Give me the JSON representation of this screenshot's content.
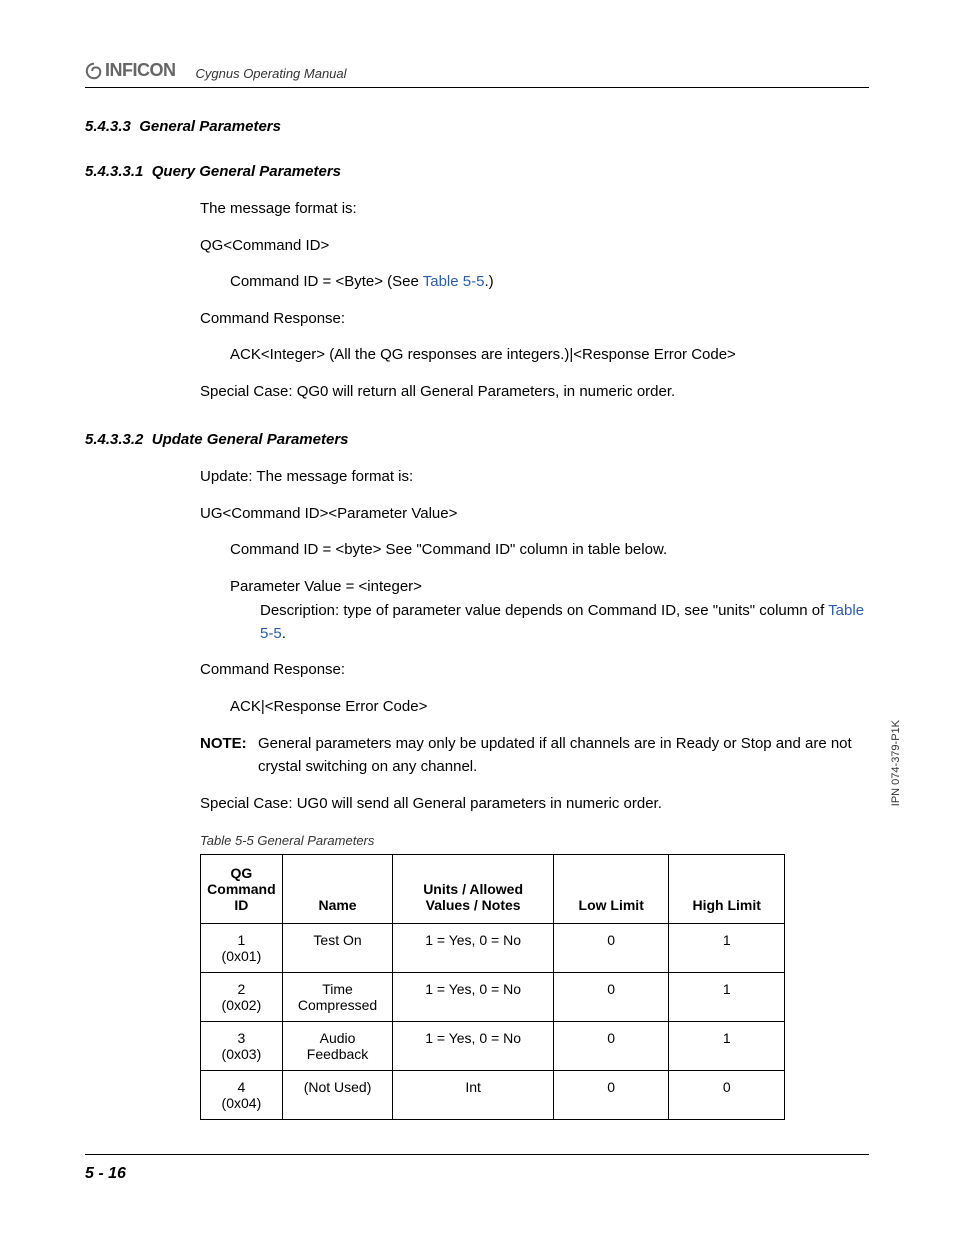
{
  "header": {
    "logo_text": "INFICON",
    "doc_title": "Cygnus Operating Manual"
  },
  "section_5_4_3_3": {
    "number": "5.4.3.3",
    "title": "General Parameters"
  },
  "section_5_4_3_3_1": {
    "number": "5.4.3.3.1",
    "title": "Query General Parameters",
    "msg_format_label": "The message format is:",
    "qg_line": "QG<Command ID>",
    "cmd_id_prefix": "Command ID = <Byte> (See ",
    "cmd_id_link": "Table 5-5",
    "cmd_id_suffix": ".)",
    "cmd_response_label": "Command Response:",
    "ack_line": "ACK<Integer> (All the QG responses are integers.)|<Response Error Code>",
    "special_case": "Special Case: QG0 will return all General Parameters, in numeric order."
  },
  "section_5_4_3_3_2": {
    "number": "5.4.3.3.2",
    "title": "Update General Parameters",
    "update_label": "Update: The message format is:",
    "ug_line": "UG<Command ID><Parameter Value>",
    "cmd_id_line": "Command ID = <byte> See \"Command ID\" column in table below.",
    "param_val_line1": "Parameter Value = <integer>",
    "param_val_desc_prefix": "Description: type of parameter value depends on Command ID, see \"units\" column of ",
    "param_val_link": "Table 5-5",
    "param_val_suffix": ".",
    "cmd_response_label": "Command Response:",
    "ack_line": "ACK|<Response Error Code>",
    "note_label": "NOTE:",
    "note_text": "General parameters may only be updated if all channels are in Ready or Stop and are not crystal switching on any channel.",
    "special_case": "Special Case: UG0 will send all General parameters in numeric order."
  },
  "table": {
    "caption": "Table 5-5  General Parameters",
    "headers": {
      "id": "QG Command ID",
      "name": "Name",
      "units": "Units / Allowed Values / Notes",
      "low": "Low Limit",
      "high": "High Limit"
    },
    "rows": [
      {
        "id_num": "1",
        "id_hex": "(0x01)",
        "name": "Test On",
        "units": "1 = Yes, 0 = No",
        "low": "0",
        "high": "1"
      },
      {
        "id_num": "2",
        "id_hex": "(0x02)",
        "name": "Time Compressed",
        "units": "1 = Yes, 0 = No",
        "low": "0",
        "high": "1"
      },
      {
        "id_num": "3",
        "id_hex": "(0x03)",
        "name": "Audio Feedback",
        "units": "1 = Yes, 0 = No",
        "low": "0",
        "high": "1"
      },
      {
        "id_num": "4",
        "id_hex": "(0x04)",
        "name": "(Not Used)",
        "units": "Int",
        "low": "0",
        "high": "0"
      }
    ]
  },
  "side_text": "IPN 074-379-P1K",
  "footer_page": "5 - 16"
}
